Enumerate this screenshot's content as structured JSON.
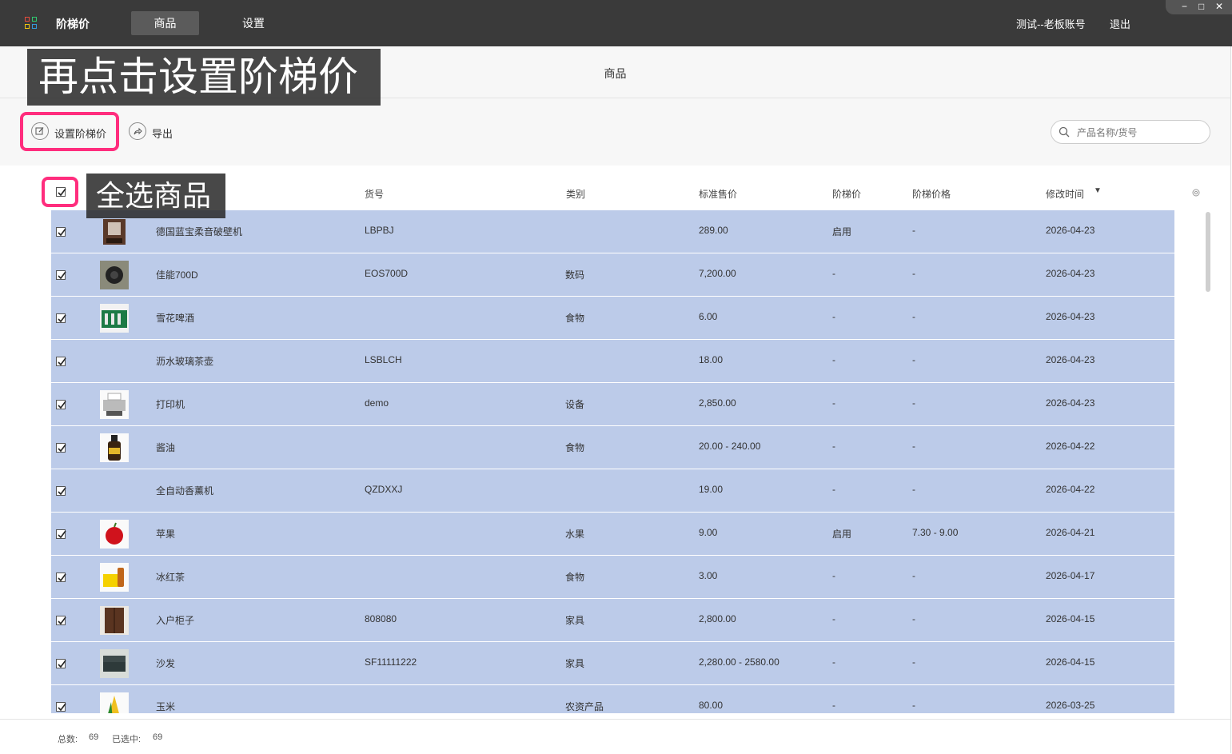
{
  "topbar": {
    "app_title": "阶梯价",
    "nav": [
      "商品",
      "设置"
    ],
    "account": "测试--老板账号",
    "logout": "退出",
    "window_controls": [
      "−",
      "□",
      "✕"
    ]
  },
  "page": {
    "title": "商品"
  },
  "toolbar": {
    "set_tier_price": "设置阶梯价",
    "export": "导出",
    "search_placeholder": "产品名称/货号"
  },
  "tips": {
    "tip1": "再点击设置阶梯价",
    "tip2": "全选商品"
  },
  "table": {
    "columns": [
      "货号",
      "类别",
      "标准售价",
      "阶梯价",
      "阶梯价格",
      "修改时间"
    ],
    "sort_indicator": "▼",
    "rows": [
      {
        "name": "德国蓝宝柔音破壁机",
        "sku": "LBPBJ",
        "category": "",
        "price": "289.00",
        "tier": "启用",
        "tier_price": "-",
        "modified": "2026-04-23",
        "thumb": "blender"
      },
      {
        "name": "佳能700D",
        "sku": "EOS700D",
        "category": "数码",
        "price": "7,200.00",
        "tier": "-",
        "tier_price": "-",
        "modified": "2026-04-23",
        "thumb": "camera"
      },
      {
        "name": "雪花啤酒",
        "sku": "",
        "category": "食物",
        "price": "6.00",
        "tier": "-",
        "tier_price": "-",
        "modified": "2026-04-23",
        "thumb": "beer"
      },
      {
        "name": "沥水玻璃茶壶",
        "sku": "LSBLCH",
        "category": "",
        "price": "18.00",
        "tier": "-",
        "tier_price": "-",
        "modified": "2026-04-23",
        "thumb": ""
      },
      {
        "name": "打印机",
        "sku": "demo",
        "category": "设备",
        "price": "2,850.00",
        "tier": "-",
        "tier_price": "-",
        "modified": "2026-04-23",
        "thumb": "printer"
      },
      {
        "name": "酱油",
        "sku": "",
        "category": "食物",
        "price": "20.00 - 240.00",
        "tier": "-",
        "tier_price": "-",
        "modified": "2026-04-22",
        "thumb": "soy"
      },
      {
        "name": "全自动香薰机",
        "sku": "QZDXXJ",
        "category": "",
        "price": "19.00",
        "tier": "-",
        "tier_price": "-",
        "modified": "2026-04-22",
        "thumb": ""
      },
      {
        "name": "苹果",
        "sku": "",
        "category": "水果",
        "price": "9.00",
        "tier": "启用",
        "tier_price": "7.30 - 9.00",
        "modified": "2026-04-21",
        "thumb": "apple"
      },
      {
        "name": "冰红茶",
        "sku": "",
        "category": "食物",
        "price": "3.00",
        "tier": "-",
        "tier_price": "-",
        "modified": "2026-04-17",
        "thumb": "tea"
      },
      {
        "name": "入户柜子",
        "sku": "808080",
        "category": "家具",
        "price": "2,800.00",
        "tier": "-",
        "tier_price": "-",
        "modified": "2026-04-15",
        "thumb": "cabinet"
      },
      {
        "name": "沙发",
        "sku": "SF11111222",
        "category": "家具",
        "price": "2,280.00 - 2580.00",
        "tier": "-",
        "tier_price": "-",
        "modified": "2026-04-15",
        "thumb": "sofa"
      },
      {
        "name": "玉米",
        "sku": "",
        "category": "农资产品",
        "price": "80.00",
        "tier": "-",
        "tier_price": "-",
        "modified": "2026-03-25",
        "thumb": "corn"
      }
    ]
  },
  "footer": {
    "total_label": "总数:",
    "total": "69",
    "selected_label": "已选中:",
    "selected": "69"
  },
  "colors": {
    "highlight": "#ff2d7d",
    "row_selected": "#bccbe9",
    "topbar": "#3a3a3a"
  }
}
